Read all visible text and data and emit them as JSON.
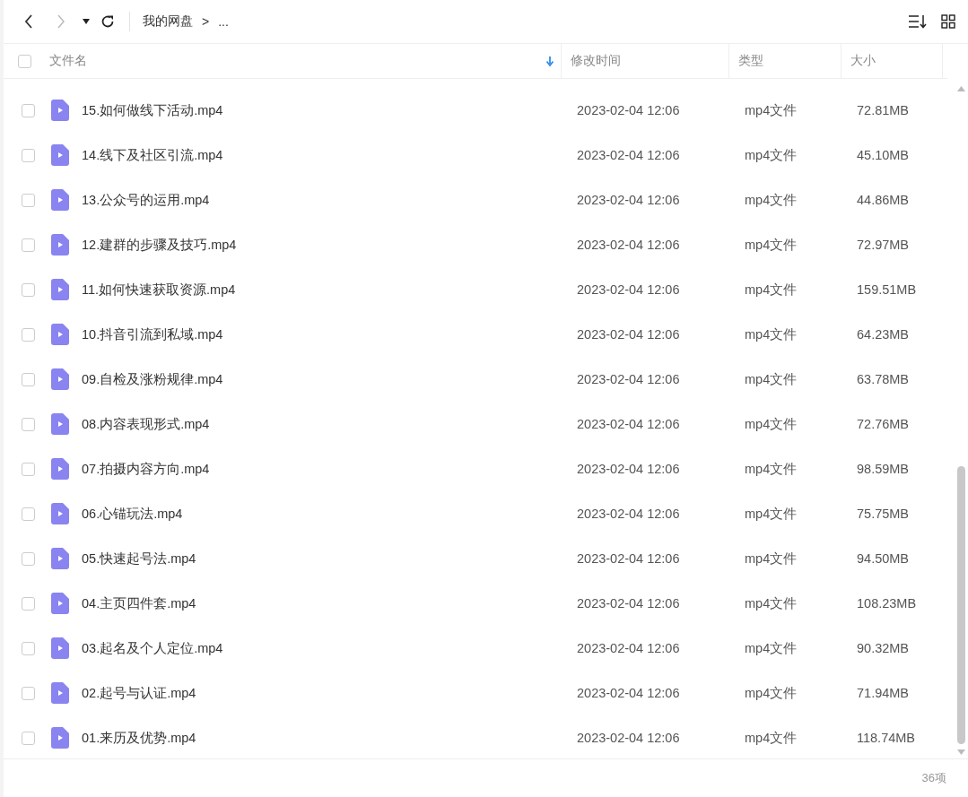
{
  "toolbar": {
    "breadcrumb": [
      {
        "label": "我的网盘"
      },
      {
        "label": ">"
      },
      {
        "label": "..."
      }
    ]
  },
  "table": {
    "columns": [
      {
        "label": "文件名",
        "sorted": true
      },
      {
        "label": "修改时间",
        "sorted": false
      },
      {
        "label": "类型",
        "sorted": false
      },
      {
        "label": "大小",
        "sorted": false
      }
    ],
    "select_all": {
      "checked": false
    },
    "rows": [
      {
        "name": "15.如何做线下活动.mp4",
        "modified": "2023-02-04 12:06",
        "type": "mp4文件",
        "size": "72.81MB",
        "checked": false
      },
      {
        "name": "14.线下及社区引流.mp4",
        "modified": "2023-02-04 12:06",
        "type": "mp4文件",
        "size": "45.10MB",
        "checked": false
      },
      {
        "name": "13.公众号的运用.mp4",
        "modified": "2023-02-04 12:06",
        "type": "mp4文件",
        "size": "44.86MB",
        "checked": false
      },
      {
        "name": "12.建群的步骤及技巧.mp4",
        "modified": "2023-02-04 12:06",
        "type": "mp4文件",
        "size": "72.97MB",
        "checked": false
      },
      {
        "name": "11.如何快速获取资源.mp4",
        "modified": "2023-02-04 12:06",
        "type": "mp4文件",
        "size": "159.51MB",
        "checked": false
      },
      {
        "name": "10.抖音引流到私域.mp4",
        "modified": "2023-02-04 12:06",
        "type": "mp4文件",
        "size": "64.23MB",
        "checked": false
      },
      {
        "name": "09.自检及涨粉规律.mp4",
        "modified": "2023-02-04 12:06",
        "type": "mp4文件",
        "size": "63.78MB",
        "checked": false
      },
      {
        "name": "08.内容表现形式.mp4",
        "modified": "2023-02-04 12:06",
        "type": "mp4文件",
        "size": "72.76MB",
        "checked": false
      },
      {
        "name": "07.拍摄内容方向.mp4",
        "modified": "2023-02-04 12:06",
        "type": "mp4文件",
        "size": "98.59MB",
        "checked": false
      },
      {
        "name": "06.心锚玩法.mp4",
        "modified": "2023-02-04 12:06",
        "type": "mp4文件",
        "size": "75.75MB",
        "checked": false
      },
      {
        "name": "05.快速起号法.mp4",
        "modified": "2023-02-04 12:06",
        "type": "mp4文件",
        "size": "94.50MB",
        "checked": false
      },
      {
        "name": "04.主页四件套.mp4",
        "modified": "2023-02-04 12:06",
        "type": "mp4文件",
        "size": "108.23MB",
        "checked": false
      },
      {
        "name": "03.起名及个人定位.mp4",
        "modified": "2023-02-04 12:06",
        "type": "mp4文件",
        "size": "90.32MB",
        "checked": false
      },
      {
        "name": "02.起号与认证.mp4",
        "modified": "2023-02-04 12:06",
        "type": "mp4文件",
        "size": "71.94MB",
        "checked": false
      },
      {
        "name": "01.来历及优势.mp4",
        "modified": "2023-02-04 12:06",
        "type": "mp4文件",
        "size": "118.74MB",
        "checked": false
      }
    ]
  },
  "status_bar": {
    "count": "36项"
  }
}
